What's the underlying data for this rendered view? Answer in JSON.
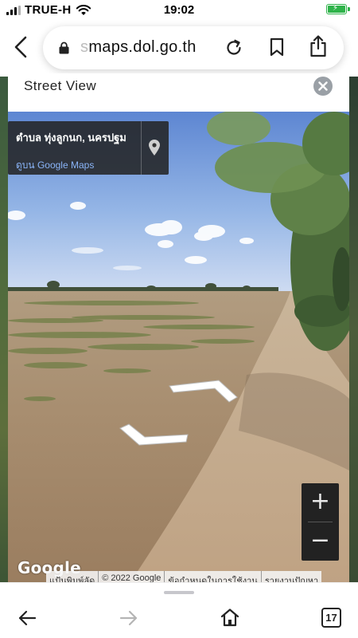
{
  "status_bar": {
    "carrier": "TRUE-H",
    "time": "19:02",
    "battery_color": "#2fb34a"
  },
  "browser": {
    "url_faded": "s",
    "url_main": "maps.dol.go.th",
    "icons": [
      "back-chevron-icon",
      "lock-icon",
      "reload-icon",
      "bookmark-icon",
      "share-icon"
    ]
  },
  "panel": {
    "title": "Street View",
    "info_card": {
      "place": "ตำบล ทุ่งลูกนก, นครปฐม",
      "link": "ดูบน Google Maps"
    },
    "zoom_in": "+",
    "zoom_out": "−",
    "google_logo": "Google",
    "attribution": [
      "แป้นพิมพ์ลัด",
      "© 2022 Google",
      "ข้อกำหนดในการใช้งาน",
      "รายงานปัญหา"
    ]
  },
  "toolbar": {
    "tabs_count": "17",
    "icons": [
      "back-arrow-icon",
      "forward-arrow-icon",
      "home-icon",
      "tabs-icon"
    ]
  }
}
